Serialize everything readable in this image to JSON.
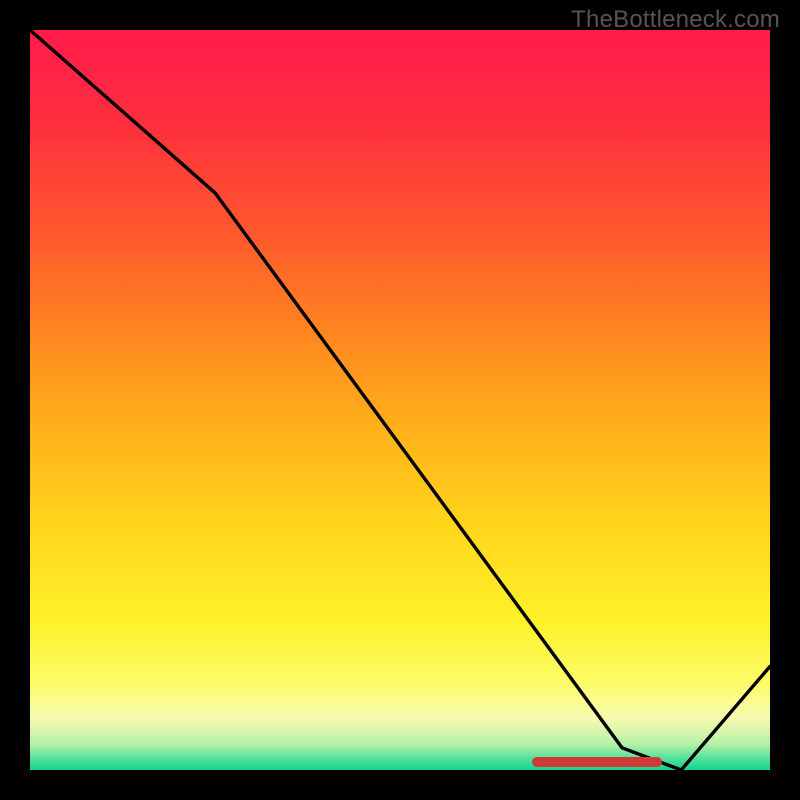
{
  "watermark": "TheBottleneck.com",
  "colors": {
    "bg": "#000000",
    "line": "#000000",
    "blob": "#cf3a37",
    "watermark": "#555555",
    "gradient_stops": [
      {
        "offset": 0.0,
        "color": "#ff1c4b"
      },
      {
        "offset": 0.12,
        "color": "#ff2d3e"
      },
      {
        "offset": 0.28,
        "color": "#ff5a2c"
      },
      {
        "offset": 0.42,
        "color": "#ff8a1f"
      },
      {
        "offset": 0.55,
        "color": "#ffb41a"
      },
      {
        "offset": 0.68,
        "color": "#ffd81c"
      },
      {
        "offset": 0.8,
        "color": "#fff12a"
      },
      {
        "offset": 0.88,
        "color": "#fcfc66"
      },
      {
        "offset": 0.93,
        "color": "#f7fbb0"
      },
      {
        "offset": 0.965,
        "color": "#b6f0a7"
      },
      {
        "offset": 0.985,
        "color": "#4fe09a"
      },
      {
        "offset": 1.0,
        "color": "#11d58f"
      }
    ]
  },
  "chart_data": {
    "type": "line",
    "title": "",
    "xlabel": "",
    "ylabel": "",
    "xlim": [
      0,
      100
    ],
    "ylim": [
      0,
      100
    ],
    "series": [
      {
        "name": "bottleneck-curve",
        "x": [
          0,
          25,
          80,
          88,
          100
        ],
        "y": [
          100,
          78,
          3,
          0,
          14
        ]
      }
    ],
    "annotations": [
      {
        "name": "optimal-range-marker",
        "x_range": [
          68,
          85
        ],
        "y": 0
      }
    ]
  }
}
